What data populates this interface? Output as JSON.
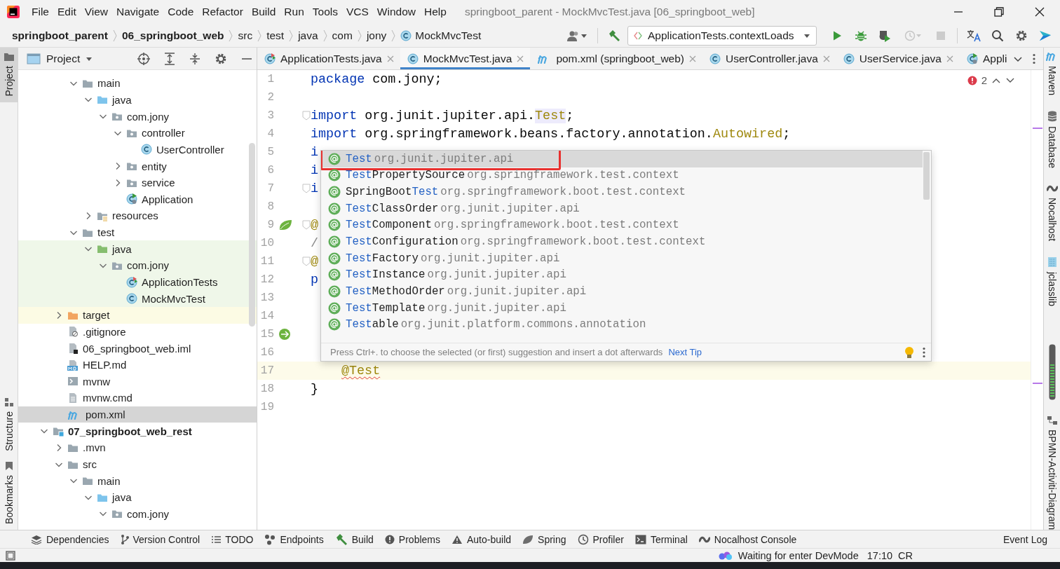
{
  "window": {
    "title": "springboot_parent - MockMvcTest.java [06_springboot_web]"
  },
  "menu": [
    "File",
    "Edit",
    "View",
    "Navigate",
    "Code",
    "Refactor",
    "Build",
    "Run",
    "Tools",
    "VCS",
    "Window",
    "Help"
  ],
  "breadcrumbs": [
    {
      "label": "springboot_parent",
      "kind": "project"
    },
    {
      "label": "06_springboot_web",
      "kind": "module"
    },
    {
      "label": "src",
      "kind": "folder"
    },
    {
      "label": "test",
      "kind": "folder"
    },
    {
      "label": "java",
      "kind": "folder"
    },
    {
      "label": "com",
      "kind": "folder"
    },
    {
      "label": "jony",
      "kind": "folder"
    },
    {
      "label": "MockMvcTest",
      "kind": "class"
    }
  ],
  "toolbar_left": [
    {
      "kind": "user",
      "disabled": false
    },
    {
      "kind": "build",
      "disabled": false
    }
  ],
  "run_config": {
    "label": "ApplicationTests.contextLoads"
  },
  "toolbar_right": [
    {
      "kind": "run",
      "disabled": false
    },
    {
      "kind": "debug",
      "disabled": false
    },
    {
      "kind": "coverage",
      "disabled": false
    },
    {
      "kind": "profile",
      "disabled": true
    },
    {
      "kind": "stop",
      "disabled": true
    },
    {
      "kind": "translate",
      "disabled": false
    },
    {
      "kind": "search",
      "disabled": false
    },
    {
      "kind": "settings",
      "disabled": false
    },
    {
      "kind": "plugin",
      "disabled": false
    }
  ],
  "left_strip": {
    "top": [
      {
        "label": "Project",
        "selected": true
      }
    ],
    "bottom": [
      {
        "label": "Structure",
        "selected": false
      },
      {
        "label": "Bookmarks",
        "selected": false
      }
    ]
  },
  "project_panel": {
    "title": "Project",
    "tree": [
      {
        "children": [
          {
            "children": [
              {
                "label": "main",
                "kind": "folder",
                "expanded": true,
                "selected": false,
                "children": [
                  {
                    "label": "java",
                    "kind": "folder-source",
                    "expanded": true,
                    "selected": false,
                    "children": [
                      {
                        "label": "com.jony",
                        "kind": "package",
                        "expanded": true,
                        "selected": false,
                        "children": [
                          {
                            "label": "controller",
                            "kind": "package",
                            "expanded": true,
                            "selected": false,
                            "children": [
                              {
                                "label": "UserController",
                                "kind": "class",
                                "selected": false
                              }
                            ]
                          },
                          {
                            "label": "entity",
                            "kind": "package",
                            "expanded": false,
                            "selected": false
                          },
                          {
                            "label": "service",
                            "kind": "package",
                            "expanded": false,
                            "selected": false
                          },
                          {
                            "label": "Application",
                            "kind": "run-class",
                            "selected": false
                          }
                        ]
                      }
                    ]
                  },
                  {
                    "label": "resources",
                    "kind": "folder-resources",
                    "expanded": false,
                    "selected": false
                  }
                ]
              },
              {
                "label": "test",
                "kind": "folder",
                "expanded": true,
                "selected": false,
                "children": [
                  {
                    "label": "java",
                    "kind": "folder-test",
                    "expanded": true,
                    "selected": false,
                    "children": [
                      {
                        "label": "com.jony",
                        "kind": "package",
                        "expanded": true,
                        "selected": false,
                        "children": [
                          {
                            "label": "ApplicationTests",
                            "kind": "test-class",
                            "selected": false
                          },
                          {
                            "label": "MockMvcTest",
                            "kind": "class",
                            "selected": false
                          }
                        ]
                      }
                    ]
                  }
                ]
              }
            ]
          },
          {
            "label": "target",
            "kind": "folder-excluded",
            "expanded": false,
            "selected": false
          },
          {
            "label": ".gitignore",
            "kind": "file-git",
            "selected": false
          },
          {
            "label": "06_springboot_web.iml",
            "kind": "file-iml",
            "selected": false
          },
          {
            "label": "HELP.md",
            "kind": "file-md",
            "selected": false
          },
          {
            "label": "mvnw",
            "kind": "file-script",
            "selected": false
          },
          {
            "label": "mvnw.cmd",
            "kind": "file-text",
            "selected": false
          },
          {
            "label": "pom.xml",
            "kind": "maven",
            "selected": true
          }
        ]
      },
      {
        "label": "07_springboot_web_rest",
        "kind": "module",
        "expanded": true,
        "selected": false,
        "children": [
          {
            "label": ".mvn",
            "kind": "folder",
            "expanded": false,
            "selected": false
          },
          {
            "label": "src",
            "kind": "folder",
            "expanded": true,
            "selected": false,
            "children": [
              {
                "label": "main",
                "kind": "folder",
                "expanded": true,
                "selected": false,
                "children": [
                  {
                    "label": "java",
                    "kind": "folder-source",
                    "expanded": true,
                    "selected": false,
                    "children": [
                      {
                        "label": "com.jony",
                        "kind": "package",
                        "expanded": true,
                        "selected": false
                      }
                    ]
                  }
                ]
              }
            ]
          }
        ]
      }
    ]
  },
  "tabs": [
    {
      "label": "ApplicationTests.java",
      "kind": "test-class",
      "selected": false,
      "closable": true
    },
    {
      "label": "MockMvcTest.java",
      "kind": "class",
      "selected": true,
      "closable": true
    },
    {
      "label": "pom.xml (springboot_web)",
      "kind": "maven",
      "selected": false,
      "closable": true
    },
    {
      "label": "UserController.java",
      "kind": "class",
      "selected": false,
      "closable": true
    },
    {
      "label": "UserService.java",
      "kind": "class",
      "selected": false,
      "closable": true
    },
    {
      "label": "Appli",
      "kind": "run-class",
      "selected": false,
      "closable": false
    }
  ],
  "editor": {
    "problems": {
      "count": "2"
    },
    "lines": [
      {
        "number": "1",
        "fold": false,
        "current": false,
        "tokens": [
          {
            "text": "package",
            "kind": "keyword"
          },
          {
            "text": " com.jony;",
            "kind": "plain"
          }
        ]
      },
      {
        "number": "2",
        "fold": false,
        "current": false
      },
      {
        "number": "3",
        "fold": true,
        "current": false,
        "tokens": [
          {
            "text": "import",
            "kind": "keyword"
          },
          {
            "text": " org.junit.jupiter.api.",
            "kind": "plain"
          },
          {
            "text": "Test",
            "kind": "usage"
          },
          {
            "text": ";",
            "kind": "plain"
          }
        ]
      },
      {
        "number": "4",
        "fold": false,
        "current": false,
        "tokens": [
          {
            "text": "import",
            "kind": "keyword"
          },
          {
            "text": " org.springframework.beans.factory.annotation.",
            "kind": "plain"
          },
          {
            "text": "Autowired",
            "kind": "annotation"
          },
          {
            "text": ";",
            "kind": "plain"
          }
        ]
      },
      {
        "number": "5",
        "fold": false,
        "current": false,
        "tokens": [
          {
            "text": "i",
            "kind": "keyword"
          }
        ]
      },
      {
        "number": "6",
        "fold": false,
        "current": false,
        "tokens": [
          {
            "text": "i",
            "kind": "keyword"
          }
        ]
      },
      {
        "number": "7",
        "fold": true,
        "current": false,
        "tokens": [
          {
            "text": "i",
            "kind": "keyword"
          }
        ]
      },
      {
        "number": "8",
        "fold": false,
        "current": false
      },
      {
        "number": "9",
        "fold": true,
        "current": false,
        "gutter": {
          "kind": "spring"
        },
        "tokens": [
          {
            "text": "@",
            "kind": "annotation"
          }
        ]
      },
      {
        "number": "10",
        "fold": false,
        "current": false,
        "tokens": [
          {
            "text": "/",
            "kind": "comment"
          }
        ]
      },
      {
        "number": "11",
        "fold": true,
        "current": false,
        "tokens": [
          {
            "text": "@",
            "kind": "annotation"
          }
        ]
      },
      {
        "number": "12",
        "fold": false,
        "current": false,
        "tokens": [
          {
            "text": "p",
            "kind": "keyword"
          }
        ]
      },
      {
        "number": "13",
        "fold": false,
        "current": false
      },
      {
        "number": "14",
        "fold": false,
        "current": false
      },
      {
        "number": "15",
        "fold": false,
        "current": false,
        "gutter": {
          "kind": "spring-run"
        }
      },
      {
        "number": "16",
        "fold": false,
        "current": false
      },
      {
        "number": "17",
        "fold": false,
        "current": true,
        "indented": true,
        "tokens": [
          {
            "text": "@Test",
            "kind": "error"
          }
        ]
      },
      {
        "number": "18",
        "fold": false,
        "current": false,
        "tokens": [
          {
            "text": "}",
            "kind": "plain"
          }
        ]
      },
      {
        "number": "19",
        "fold": false,
        "current": false
      }
    ]
  },
  "completion": {
    "items": [
      {
        "match": "Test",
        "package": "org.junit.jupiter.api",
        "selected": true,
        "outlined": true
      },
      {
        "match": "Test",
        "rest": "PropertySource",
        "package": "org.springframework.test.context",
        "selected": false,
        "outlined": false
      },
      {
        "prefix": "SpringBoot",
        "match": "Test",
        "package": "org.springframework.boot.test.context",
        "selected": false,
        "outlined": false
      },
      {
        "match": "Test",
        "rest": "ClassOrder",
        "package": "org.junit.jupiter.api",
        "selected": false,
        "outlined": false
      },
      {
        "match": "Test",
        "rest": "Component",
        "package": "org.springframework.boot.test.context",
        "selected": false,
        "outlined": false
      },
      {
        "match": "Test",
        "rest": "Configuration",
        "package": "org.springframework.boot.test.context",
        "selected": false,
        "outlined": false
      },
      {
        "match": "Test",
        "rest": "Factory",
        "package": "org.junit.jupiter.api",
        "selected": false,
        "outlined": false
      },
      {
        "match": "Test",
        "rest": "Instance",
        "package": "org.junit.jupiter.api",
        "selected": false,
        "outlined": false
      },
      {
        "match": "Test",
        "rest": "MethodOrder",
        "package": "org.junit.jupiter.api",
        "selected": false,
        "outlined": false
      },
      {
        "match": "Test",
        "rest": "Template",
        "package": "org.junit.jupiter.api",
        "selected": false,
        "outlined": false
      },
      {
        "match": "Test",
        "rest": "able",
        "package": "org.junit.platform.commons.annotation",
        "selected": false,
        "outlined": false
      }
    ],
    "hint": "Press Ctrl+. to choose the selected (or first) suggestion and insert a dot afterwards",
    "hint_link": "Next Tip"
  },
  "right_strip": [
    {
      "label": "Maven",
      "kind": "maven"
    },
    {
      "label": "Database",
      "kind": "database"
    },
    {
      "label": "Nocalhost",
      "kind": "nocalhost"
    },
    {
      "label": "jclasslib",
      "kind": "jclasslib"
    },
    {
      "label": "BPMN-Activiti-Diagram",
      "kind": "bpmn"
    }
  ],
  "tool_windows": [
    {
      "label": "Dependencies",
      "kind": "dependencies"
    },
    {
      "label": "Version Control",
      "kind": "vcs"
    },
    {
      "label": "TODO",
      "kind": "todo"
    },
    {
      "label": "Endpoints",
      "kind": "endpoints"
    },
    {
      "label": "Build",
      "kind": "build"
    },
    {
      "label": "Problems",
      "kind": "problems"
    },
    {
      "label": "Auto-build",
      "kind": "warning"
    },
    {
      "label": "Spring",
      "kind": "spring"
    },
    {
      "label": "Profiler",
      "kind": "profiler"
    },
    {
      "label": "Terminal",
      "kind": "terminal"
    },
    {
      "label": "Nocalhost Console",
      "kind": "nocalhost"
    }
  ],
  "event_log": {
    "label": "Event Log"
  },
  "status_bar": {
    "message": "Waiting for enter DevMode",
    "position": "17:10",
    "line_separator": "CR"
  }
}
